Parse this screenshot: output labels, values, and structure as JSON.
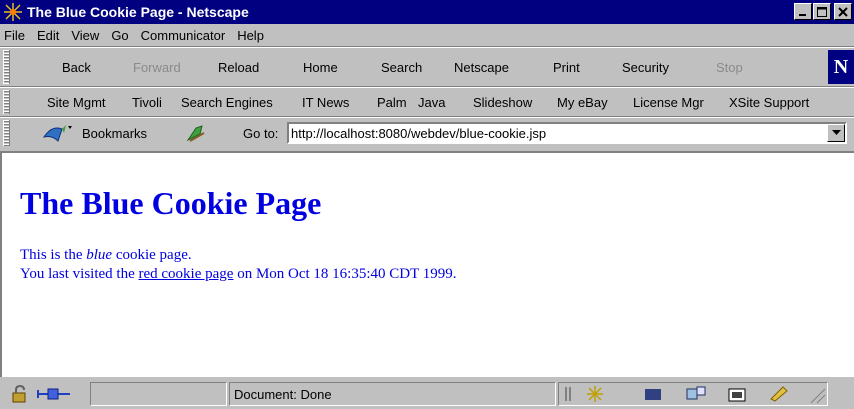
{
  "window": {
    "title": "The Blue Cookie Page - Netscape"
  },
  "menu": [
    "File",
    "Edit",
    "View",
    "Go",
    "Communicator",
    "Help"
  ],
  "nav_toolbar": {
    "back": "Back",
    "forward": "Forward",
    "reload": "Reload",
    "home": "Home",
    "search": "Search",
    "netscape": "Netscape",
    "print": "Print",
    "security": "Security",
    "stop": "Stop",
    "logo": "N"
  },
  "links": [
    "Site Mgmt",
    "Tivoli",
    "Search Engines",
    "IT News",
    "Palm",
    "Java",
    "Slideshow",
    "My eBay",
    "License Mgr",
    "XSite Support"
  ],
  "location": {
    "bookmarks_label": "Bookmarks",
    "goto_label": "Go to:",
    "url": "http://localhost:8080/webdev/blue-cookie.jsp"
  },
  "page": {
    "heading": "The Blue Cookie Page",
    "line1_prefix": "This is the ",
    "line1_em": "blue",
    "line1_suffix": " cookie page.",
    "line2_prefix": "You last visited the ",
    "line2_link": "red cookie page",
    "line2_suffix": " on Mon Oct 18 16:35:40 CDT 1999."
  },
  "status": {
    "text": "Document: Done"
  },
  "colors": {
    "titlebar": "#000080",
    "content_text": "#0000e0",
    "chrome": "#c0c0c0"
  },
  "icons": [
    "netscape-title-icon",
    "minimize-icon",
    "maximize-icon",
    "close-icon",
    "bookmarks-icon",
    "whats-related-icon",
    "dropdown-arrow-icon",
    "security-lock-icon",
    "connection-icon",
    "component-bar-icons"
  ]
}
